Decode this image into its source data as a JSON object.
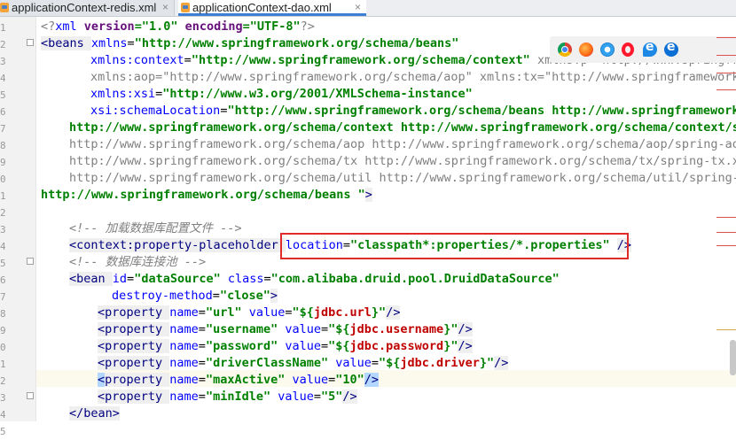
{
  "tabs": [
    {
      "label": "applicationContext-redis.xml",
      "close": "×",
      "active": false
    },
    {
      "label": "applicationContext-dao.xml",
      "close": "×",
      "active": true
    }
  ],
  "gutter": {
    "line_numbers": [
      "1",
      "2",
      "3",
      "4",
      "5",
      "6",
      "7",
      "8",
      "9",
      "0",
      "1",
      "2",
      "3",
      "4",
      "5",
      "6",
      "7",
      "8",
      "9",
      "0",
      "1",
      "2",
      "3",
      "4",
      "5"
    ]
  },
  "browser_icons": [
    "chrome-icon",
    "firefox-icon",
    "safari-icon",
    "opera-icon",
    "edge-icon",
    "edge-icon"
  ],
  "code_lines": [
    {
      "indent": 0,
      "tokens": [
        [
          "dim",
          "<?"
        ],
        [
          "attr",
          "xml "
        ],
        [
          "var",
          "version"
        ],
        [
          "str",
          "=\"1.0\" "
        ],
        [
          "var",
          "encoding"
        ],
        [
          "str",
          "=\"UTF-8\""
        ],
        [
          "dim",
          "?>"
        ]
      ]
    },
    {
      "indent": 0,
      "tokens": [
        [
          "tag",
          "<beans "
        ],
        [
          "attr",
          "xmlns"
        ],
        [
          "txt",
          "="
        ],
        [
          "str",
          "\"http://www.springframework.org/schema/beans\""
        ]
      ]
    },
    {
      "indent": 56,
      "tokens": [
        [
          "attr",
          "xmlns:context"
        ],
        [
          "txt",
          "="
        ],
        [
          "str",
          "\"http://www.springframework.org/schema/context\" "
        ],
        [
          "dim",
          "xmlns:p=\"http://www.springfr"
        ]
      ]
    },
    {
      "indent": 56,
      "tokens": [
        [
          "dim",
          "xmlns:aop=\"http://www.springframework.org/schema/aop\" xmlns:tx=\"http://www.springframework"
        ]
      ]
    },
    {
      "indent": 56,
      "tokens": [
        [
          "attr",
          "xmlns:xsi"
        ],
        [
          "txt",
          "="
        ],
        [
          "str",
          "\"http://www.w3.org/2001/XMLSchema-instance\""
        ]
      ]
    },
    {
      "indent": 56,
      "tokens": [
        [
          "attr",
          "xsi:schemaLocation"
        ],
        [
          "txt",
          "="
        ],
        [
          "str",
          "\"http://www.springframework.org/schema/beans http://www.springframework"
        ]
      ]
    },
    {
      "indent": 32,
      "tokens": [
        [
          "str",
          "http://www.springframework.org/schema/context http://www.springframework.org/schema/context/s"
        ]
      ]
    },
    {
      "indent": 32,
      "tokens": [
        [
          "dim",
          "http://www.springframework.org/schema/aop http://www.springframework.org/schema/aop/spring-ao"
        ]
      ]
    },
    {
      "indent": 32,
      "tokens": [
        [
          "dim",
          "http://www.springframework.org/schema/tx http://www.springframework.org/schema/tx/spring-tx.x"
        ]
      ]
    },
    {
      "indent": 32,
      "tokens": [
        [
          "dim",
          "http://www.springframework.org/schema/util http://www.springframework.org/schema/util/spring-"
        ]
      ]
    },
    {
      "indent": 0,
      "tokens": [
        [
          "str",
          "http://www.springframework.org/schema/beans \""
        ],
        [
          "tag",
          ">"
        ]
      ]
    },
    {
      "indent": 0,
      "tokens": []
    },
    {
      "indent": 32,
      "tokens": [
        [
          "com",
          "<!-- 加载数据库配置文件 -->"
        ]
      ]
    },
    {
      "indent": 32,
      "tokens": [
        [
          "tag",
          "<context:property-placeholder "
        ],
        [
          "attr",
          "location"
        ],
        [
          "txt",
          "="
        ],
        [
          "str",
          "\"classpath*:properties/*.properties\" "
        ],
        [
          "tag",
          "/>"
        ]
      ]
    },
    {
      "indent": 32,
      "tokens": [
        [
          "com",
          "<!-- 数据库连接池 -->"
        ]
      ]
    },
    {
      "indent": 32,
      "tokens": [
        [
          "tag",
          "<bean "
        ],
        [
          "attr",
          "id"
        ],
        [
          "txt",
          "="
        ],
        [
          "str",
          "\"dataSource\" "
        ],
        [
          "attr",
          "class"
        ],
        [
          "txt",
          "="
        ],
        [
          "str",
          "\"com.alibaba.druid.pool.DruidDataSource\""
        ]
      ]
    },
    {
      "indent": 80,
      "tokens": [
        [
          "attr",
          "destroy-method"
        ],
        [
          "txt",
          "="
        ],
        [
          "str",
          "\"close\""
        ],
        [
          "tag",
          ">"
        ]
      ]
    },
    {
      "indent": 64,
      "tokens": [
        [
          "tag",
          "<property "
        ],
        [
          "attr",
          "name"
        ],
        [
          "txt",
          "="
        ],
        [
          "str",
          "\"url\" "
        ],
        [
          "attr",
          "value"
        ],
        [
          "txt",
          "="
        ],
        [
          "str",
          "\"${"
        ],
        [
          "ref",
          "jdbc.url"
        ],
        [
          "str",
          "}\""
        ],
        [
          "tag",
          "/>"
        ]
      ]
    },
    {
      "indent": 64,
      "tokens": [
        [
          "tag",
          "<property "
        ],
        [
          "attr",
          "name"
        ],
        [
          "txt",
          "="
        ],
        [
          "str",
          "\"username\" "
        ],
        [
          "attr",
          "value"
        ],
        [
          "txt",
          "="
        ],
        [
          "str",
          "\"${"
        ],
        [
          "ref",
          "jdbc.username"
        ],
        [
          "str",
          "}\""
        ],
        [
          "tag",
          "/>"
        ]
      ]
    },
    {
      "indent": 64,
      "tokens": [
        [
          "tag",
          "<property "
        ],
        [
          "attr",
          "name"
        ],
        [
          "txt",
          "="
        ],
        [
          "str",
          "\"password\" "
        ],
        [
          "attr",
          "value"
        ],
        [
          "txt",
          "="
        ],
        [
          "str",
          "\"${"
        ],
        [
          "ref",
          "jdbc.password"
        ],
        [
          "str",
          "}\""
        ],
        [
          "tag",
          "/>"
        ]
      ]
    },
    {
      "indent": 64,
      "tokens": [
        [
          "tag",
          "<property "
        ],
        [
          "attr",
          "name"
        ],
        [
          "txt",
          "="
        ],
        [
          "str",
          "\"driverClassName\" "
        ],
        [
          "attr",
          "value"
        ],
        [
          "txt",
          "="
        ],
        [
          "str",
          "\"${"
        ],
        [
          "ref",
          "jdbc.driver"
        ],
        [
          "str",
          "}\""
        ],
        [
          "tag",
          "/>"
        ]
      ]
    },
    {
      "indent": 64,
      "tokens": [
        [
          "sel",
          "<"
        ],
        [
          "tag",
          "property "
        ],
        [
          "attr",
          "name"
        ],
        [
          "txt",
          "="
        ],
        [
          "str",
          "\"maxActive\" "
        ],
        [
          "attr",
          "value"
        ],
        [
          "txt",
          "="
        ],
        [
          "str",
          "\"10\""
        ],
        [
          "sel",
          "/>"
        ]
      ]
    },
    {
      "indent": 64,
      "tokens": [
        [
          "tag",
          "<property "
        ],
        [
          "attr",
          "name"
        ],
        [
          "txt",
          "="
        ],
        [
          "str",
          "\"minIdle\" "
        ],
        [
          "attr",
          "value"
        ],
        [
          "txt",
          "="
        ],
        [
          "str",
          "\"5\""
        ],
        [
          "tag",
          "/>"
        ]
      ]
    },
    {
      "indent": 32,
      "tokens": [
        [
          "tag",
          "</bean>"
        ]
      ]
    }
  ]
}
